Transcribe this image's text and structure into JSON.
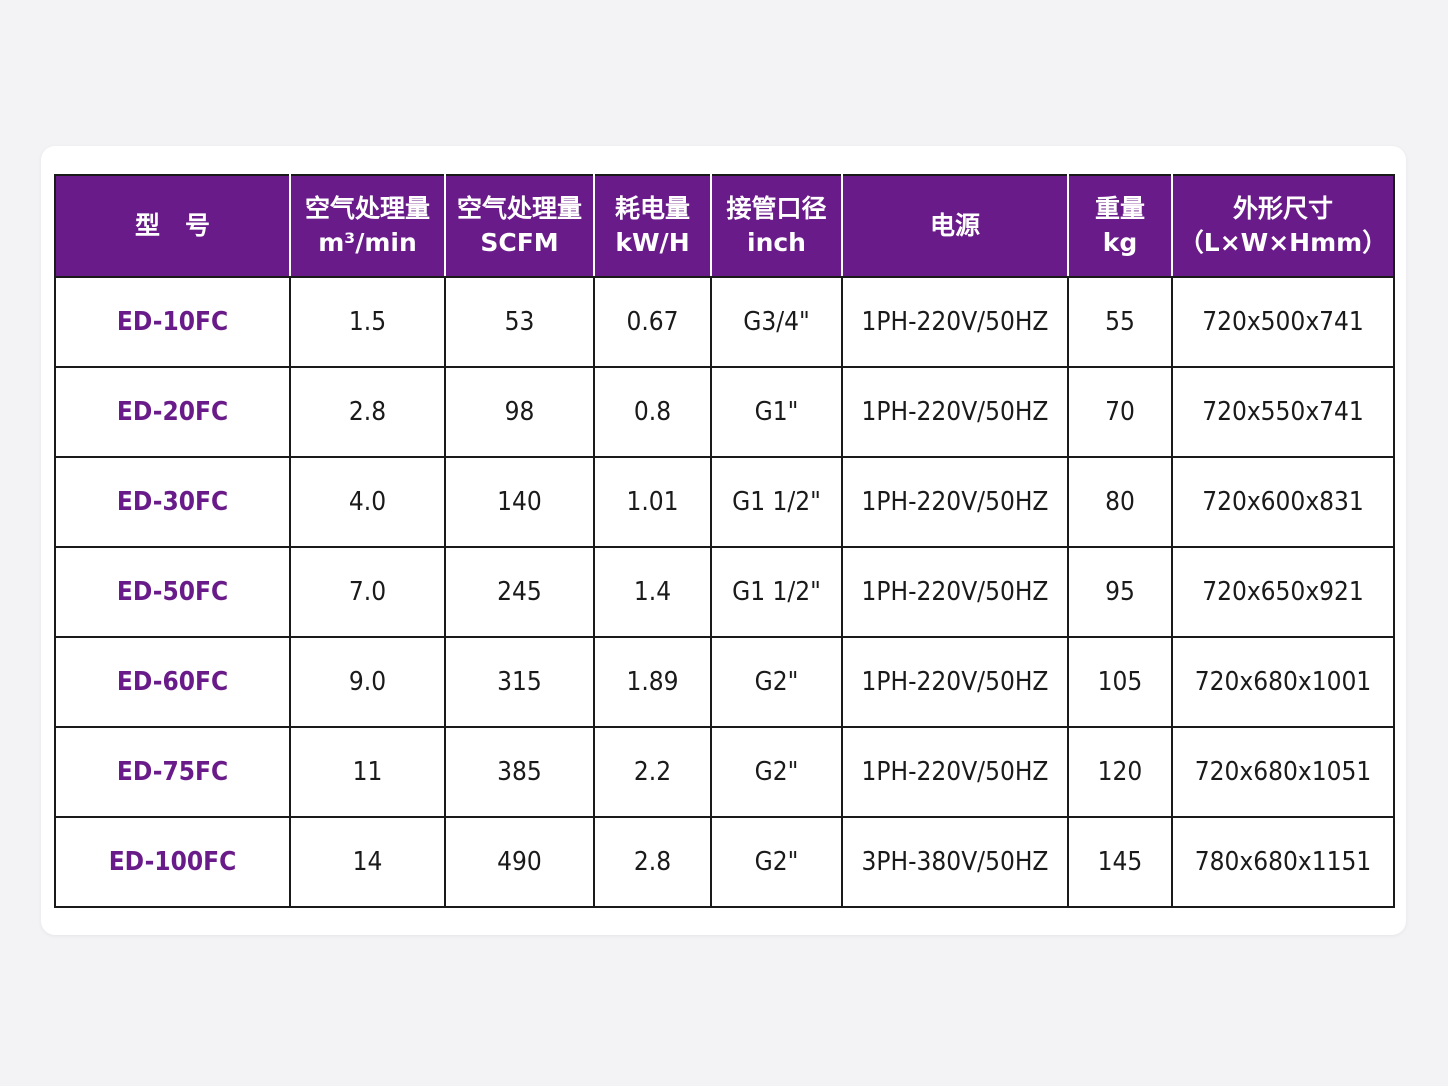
{
  "colors": {
    "header_bg": "#6a1b8a",
    "header_text": "#ffffff",
    "model_text": "#6a1b8a",
    "border": "#1a1a1a",
    "page_bg": "#f3f3f5",
    "card_bg": "#ffffff"
  },
  "table": {
    "headers": [
      {
        "line1": "型　号",
        "line2": ""
      },
      {
        "line1": "空气处理量",
        "line2": "m³/min"
      },
      {
        "line1": "空气处理量",
        "line2": "SCFM"
      },
      {
        "line1": "耗电量",
        "line2": "kW/H"
      },
      {
        "line1": "接管口径",
        "line2": "inch"
      },
      {
        "line1": "电源",
        "line2": ""
      },
      {
        "line1": "重量",
        "line2": "kg"
      },
      {
        "line1": "外形尺寸",
        "line2": "（L×W×Hmm）"
      }
    ],
    "rows": [
      {
        "model": "ED-10FC",
        "flow_m3": "1.5",
        "flow_scfm": "53",
        "power": "0.67",
        "pipe": "G3/4\"",
        "supply": "1PH-220V/50HZ",
        "weight": "55",
        "dimensions": "720x500x741"
      },
      {
        "model": "ED-20FC",
        "flow_m3": "2.8",
        "flow_scfm": "98",
        "power": "0.8",
        "pipe": "G1\"",
        "supply": "1PH-220V/50HZ",
        "weight": "70",
        "dimensions": "720x550x741"
      },
      {
        "model": "ED-30FC",
        "flow_m3": "4.0",
        "flow_scfm": "140",
        "power": "1.01",
        "pipe": "G1 1/2\"",
        "supply": "1PH-220V/50HZ",
        "weight": "80",
        "dimensions": "720x600x831"
      },
      {
        "model": "ED-50FC",
        "flow_m3": "7.0",
        "flow_scfm": "245",
        "power": "1.4",
        "pipe": "G1 1/2\"",
        "supply": "1PH-220V/50HZ",
        "weight": "95",
        "dimensions": "720x650x921"
      },
      {
        "model": "ED-60FC",
        "flow_m3": "9.0",
        "flow_scfm": "315",
        "power": "1.89",
        "pipe": "G2\"",
        "supply": "1PH-220V/50HZ",
        "weight": "105",
        "dimensions": "720x680x1001"
      },
      {
        "model": "ED-75FC",
        "flow_m3": "11",
        "flow_scfm": "385",
        "power": "2.2",
        "pipe": "G2\"",
        "supply": "1PH-220V/50HZ",
        "weight": "120",
        "dimensions": "720x680x1051"
      },
      {
        "model": "ED-100FC",
        "flow_m3": "14",
        "flow_scfm": "490",
        "power": "2.8",
        "pipe": "G2\"",
        "supply": "3PH-380V/50HZ",
        "weight": "145",
        "dimensions": "780x680x1151"
      }
    ]
  }
}
